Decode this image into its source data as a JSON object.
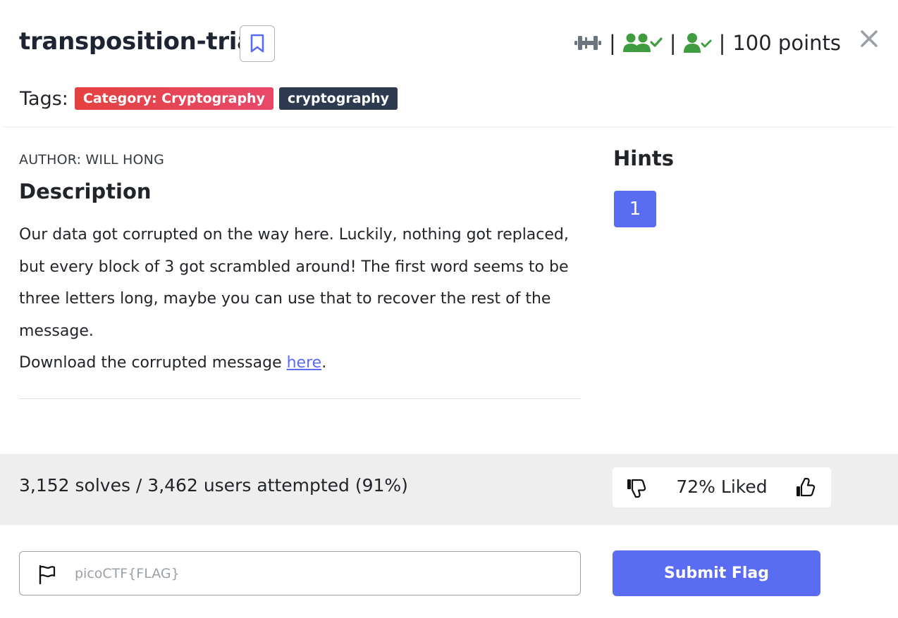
{
  "challenge": {
    "title": "transposition-trial",
    "points": "100 points",
    "separator": "|"
  },
  "tags": {
    "label": "Tags:",
    "items": [
      "Category: Cryptography",
      "cryptography"
    ]
  },
  "author": "AUTHOR: WILL HONG",
  "description": {
    "heading": "Description",
    "paragraph": "Our data got corrupted on the way here. Luckily, nothing got replaced, but every block of 3 got scrambled around! The first word seems to be three letters long, maybe you can use that to recover the rest of the message.",
    "download_prefix": "Download the corrupted message ",
    "download_link": "here",
    "download_suffix": "."
  },
  "hints": {
    "heading": "Hints",
    "items": [
      "1"
    ]
  },
  "stats": {
    "solves_text": "3,152 solves / 3,462 users attempted (91%)",
    "liked_text": "72% Liked"
  },
  "flag_form": {
    "placeholder": "picoCTF{FLAG}",
    "value": "",
    "submit_label": "Submit Flag"
  },
  "icons": {
    "difficulty": "dumbbell-icon",
    "team_solved": "users-check-icon",
    "user_solved": "user-check-icon",
    "bookmark": "bookmark-icon",
    "close": "close-icon",
    "dislike": "thumbs-down-icon",
    "like": "thumbs-up-icon",
    "flag": "flag-icon"
  },
  "colors": {
    "accent": "#5a6cf1",
    "success": "#3f9d3f",
    "category_tag": "#e3413f",
    "plain_tag": "#2e3a50",
    "band": "#eeeeee"
  }
}
